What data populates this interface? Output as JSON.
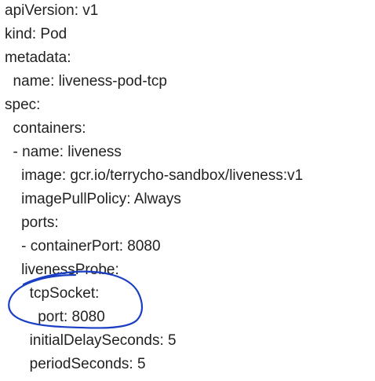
{
  "yaml_lines": [
    "apiVersion: v1",
    "kind: Pod",
    "metadata:",
    "  name: liveness-pod-tcp",
    "spec:",
    "  containers:",
    "  - name: liveness",
    "    image: gcr.io/terrycho-sandbox/liveness:v1",
    "    imagePullPolicy: Always",
    "    ports:",
    "    - containerPort: 8080",
    "    livenessProbe:",
    "      tcpSocket:",
    "        port: 8080",
    "      initialDelaySeconds: 5",
    "      periodSeconds: 5"
  ],
  "annotation": {
    "shape": "hand-drawn-circle",
    "color": "#1a3fc4",
    "highlights": "tcpSocket block"
  }
}
